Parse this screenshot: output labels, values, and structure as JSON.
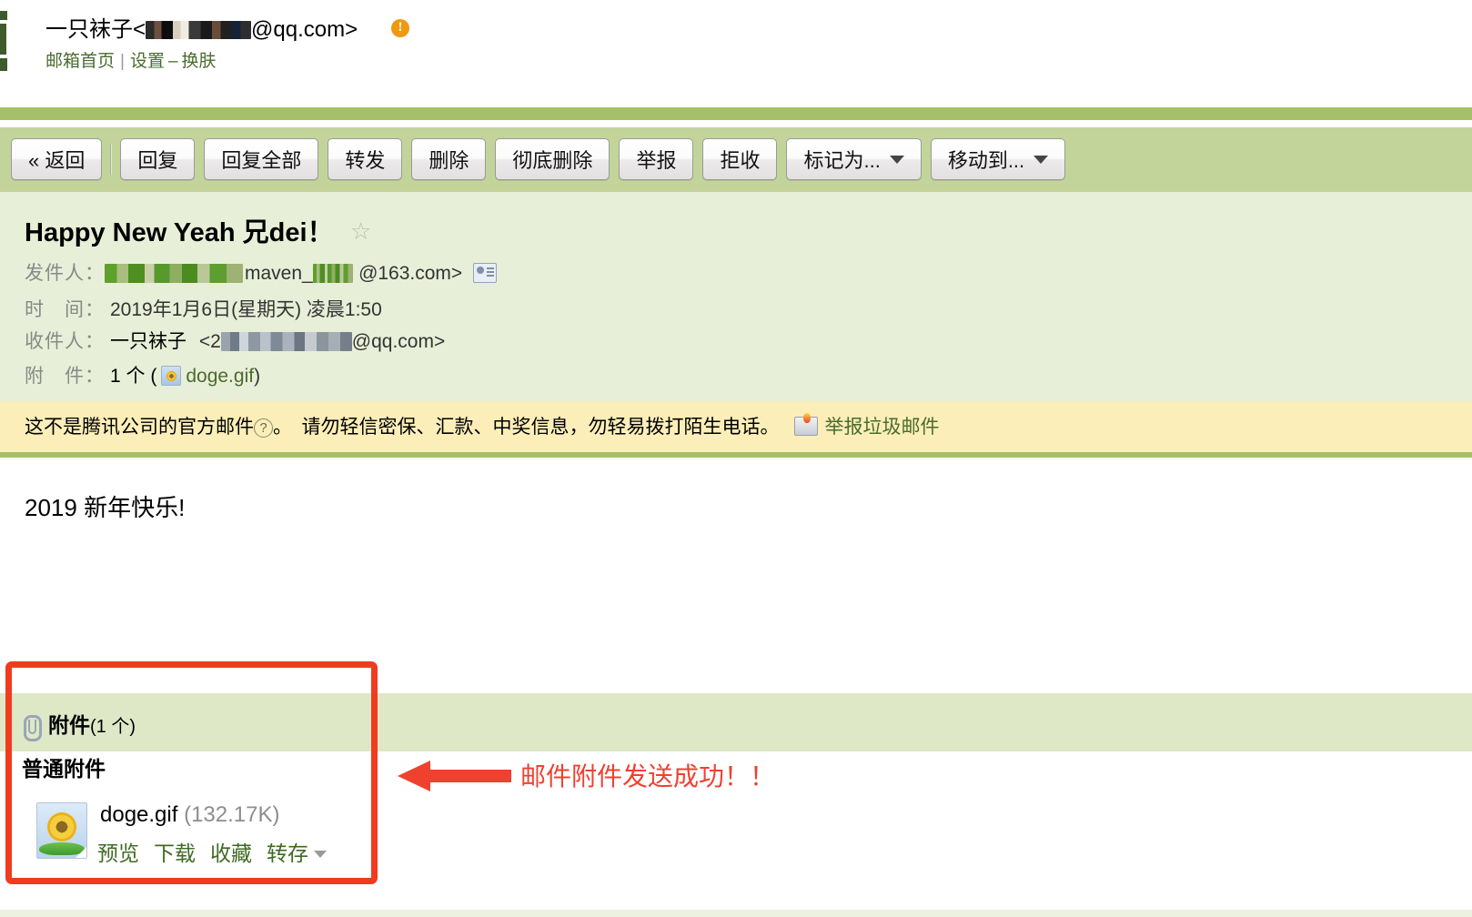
{
  "account": {
    "display_name": "一只袜子",
    "email_prefix": "<",
    "email_suffix": "@qq.com>",
    "warning_badge": "!",
    "links": {
      "home": "邮箱首页",
      "separator": "|",
      "settings": "设置",
      "dash": "–",
      "skin": "换肤"
    }
  },
  "toolbar": {
    "back": "« 返回",
    "reply": "回复",
    "reply_all": "回复全部",
    "forward": "转发",
    "delete": "删除",
    "delete_permanent": "彻底删除",
    "report": "举报",
    "reject": "拒收",
    "mark_as": "标记为...",
    "move_to": "移动到..."
  },
  "mail": {
    "subject": "Happy New Yeah 兄dei！",
    "star_glyph": "☆",
    "labels": {
      "from": "发件人：",
      "date": "时　间：",
      "to": "收件人：",
      "attachment": "附　件："
    },
    "from_value": "maven_work <maven_work@163.com>",
    "from_address_visible": "@163.com>",
    "from_name_visible": "maven_work",
    "date_value": "2019年1月6日(星期天) 凌晨1:50",
    "to_name": "一只袜子",
    "to_prefix": "<2",
    "to_suffix": "@qq.com>",
    "attachment_count_text": "1 个 (",
    "attachment_name": "doge.gif",
    "attachment_close": ")"
  },
  "warning": {
    "text_before": "这不是腾讯公司的官方邮件",
    "help_glyph": "?",
    "text_after": "。　请勿轻信密保、汇款、中奖信息，勿轻易拨打陌生电话。",
    "report_spam": "举报垃圾邮件"
  },
  "body": {
    "content": "2019 新年快乐!"
  },
  "attachments": {
    "band_title": "附件",
    "band_count": "(1 个)",
    "kind_label": "普通附件",
    "file_name": "doge.gif",
    "file_size": "(132.17K)",
    "actions": {
      "preview": "预览",
      "download": "下载",
      "favorite": "收藏",
      "save_to": "转存"
    }
  },
  "annotation": {
    "text": "邮件附件发送成功！！",
    "color": "#ef4130"
  },
  "colors": {
    "toolbar_band": "#c3d49a",
    "green_rule": "#a6c06a",
    "meta_panel": "#e8efd8",
    "warning_strip": "#fbeeb8",
    "attachment_band": "#dee8c7",
    "link_green": "#4a6b2f",
    "badge_orange": "#ee9911"
  }
}
